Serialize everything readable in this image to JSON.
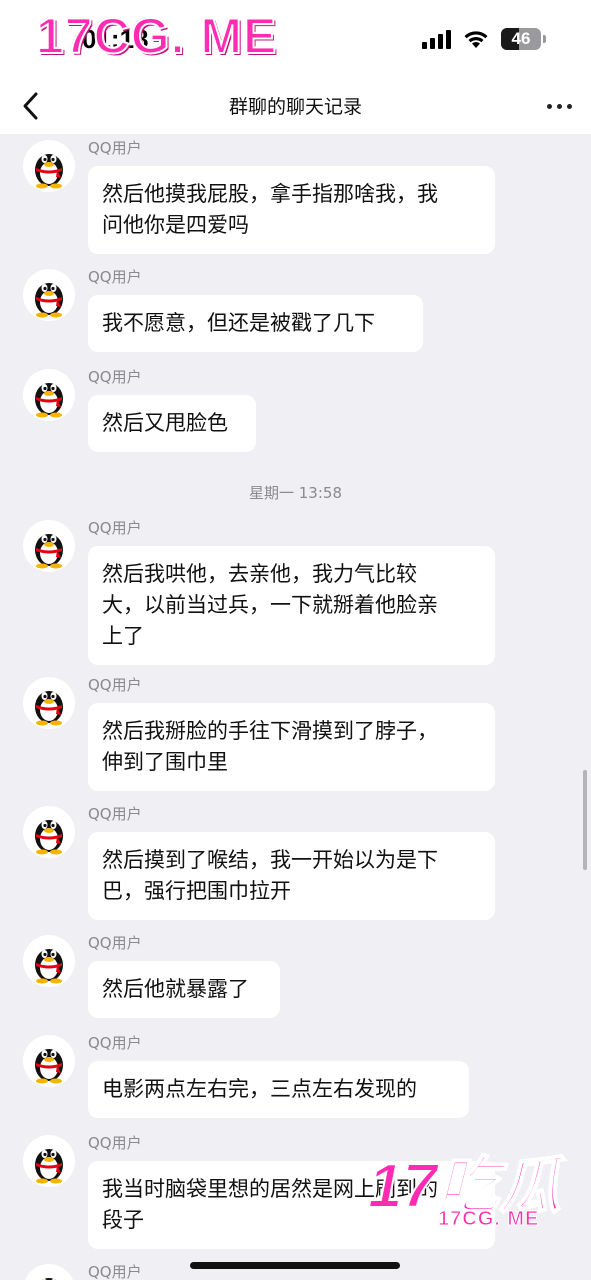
{
  "watermark": {
    "top": "17CG. ME",
    "bottom_big": "17吃瓜",
    "bottom_small": "17CG. ME"
  },
  "status_bar": {
    "time": "01:18",
    "battery": "46",
    "battery_level": 0.46,
    "icons": [
      "signal-icon",
      "wifi-icon",
      "battery-icon"
    ]
  },
  "nav": {
    "back_icon": "chevron-left-icon",
    "title": "群聊的聊天记录",
    "more_icon": "ellipsis-icon"
  },
  "timestamp": "星期一 13:58",
  "messages": [
    {
      "sender": "QQ用户",
      "text": "然后他摸我屁股，拿手指那啥我，我\n问他你是四爱吗"
    },
    {
      "sender": "QQ用户",
      "text": "我不愿意，但还是被戳了几下"
    },
    {
      "sender": "QQ用户",
      "text": "然后又甩脸色"
    },
    {
      "sender": "QQ用户",
      "text": "然后我哄他，去亲他，我力气比较\n大，以前当过兵，一下就掰着他脸亲\n上了"
    },
    {
      "sender": "QQ用户",
      "text": "然后我掰脸的手往下滑摸到了脖子，\n伸到了围巾里"
    },
    {
      "sender": "QQ用户",
      "text": "然后摸到了喉结，我一开始以为是下\n巴，强行把围巾拉开"
    },
    {
      "sender": "QQ用户",
      "text": "然后他就暴露了"
    },
    {
      "sender": "QQ用户",
      "text": "电影两点左右完，三点左右发现的"
    },
    {
      "sender": "QQ用户",
      "text": "我当时脑袋里想的居然是网上刷到的\n段子"
    },
    {
      "sender": "QQ用户",
      "text": ""
    }
  ]
}
